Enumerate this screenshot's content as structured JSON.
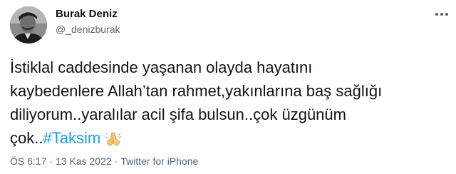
{
  "author": {
    "display_name": "Burak Deniz",
    "handle": "@_denizburak"
  },
  "tweet": {
    "lines": [
      "İstiklal caddesinde yaşanan olayda hayatını",
      "kaybedenlere Allah’tan rahmet,yakınlarına baş sağlığı",
      "diliyorum..yaralılar acil şifa bulsun..çok üzgünüm",
      "çok.."
    ],
    "hashtag": "#Taksim",
    "emoji": "folded-hands-emoji"
  },
  "meta": {
    "time": "ÖS 6:17",
    "date": "13 Kas 2022",
    "source": "Twitter for iPhone",
    "separator": "·"
  },
  "colors": {
    "text": "#0f1419",
    "secondary": "#536471",
    "link": "#1d9bf0"
  }
}
